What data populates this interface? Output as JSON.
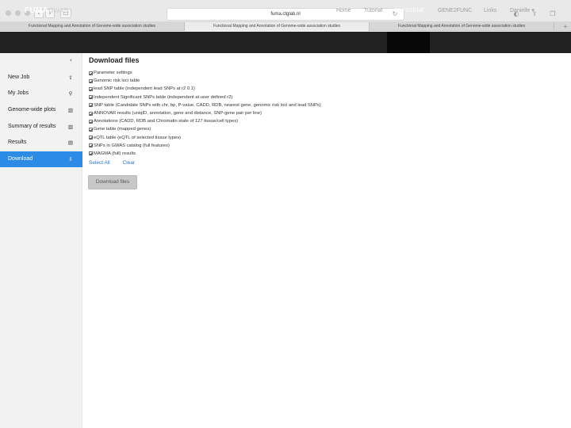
{
  "browser": {
    "url": "fuma.ctglab.nl",
    "tabs": [
      "Functional Mapping and Annotation of Genome-wide association studies",
      "Functional Mapping and Annotation of Genome-wide association studies",
      "Functional Mapping and Annotation of Genome-wide association studies"
    ],
    "new_tab": "+"
  },
  "navbar": {
    "brand_main": "FUMA",
    "brand_sub": "GWAS",
    "items": [
      "Home",
      "Tutorial",
      "SNP2GENE",
      "GENE2FUNC",
      "Links",
      "Danielle ▾"
    ],
    "active": "SNP2GENE"
  },
  "sidebar": {
    "collapse_icon": "‹",
    "items": [
      {
        "label": "New Job",
        "icon": "upload-icon"
      },
      {
        "label": "My Jobs",
        "icon": "search-icon"
      },
      {
        "label": "Genome-wide plots",
        "icon": "bar-chart-icon"
      },
      {
        "label": "Summary of results",
        "icon": "bar-chart-icon"
      },
      {
        "label": "Results",
        "icon": "table-icon"
      },
      {
        "label": "Download",
        "icon": "download-icon"
      }
    ],
    "active": "Download"
  },
  "main": {
    "title": "Download files",
    "files": [
      "Parameter settings",
      "Genomic risk loci table",
      "lead SNP table (independent lead SNPs at r2 0.1)",
      "Independent Significant SNPs table (independent at user defined r2)",
      "SNP table (Candidate SNPs with chr, bp, P-value, CADD, RDB, nearest gene, genomic risk loci and lead SNPs)",
      "ANNOVAR results (uniqID, annotation, gene and distance, SNP-gene pair per line)",
      "Annotations (CADD, RDB and Chromatin state of 127 tissue/cell types)",
      "Gene table (mapped genes)",
      "eQTL table (eQTL of selected tissue types)",
      "SNPs in GWAS catalog (full features)",
      "MAGMA (full) results"
    ],
    "select_all": "Select All",
    "clear": "Clear",
    "download_button": "Download files"
  }
}
